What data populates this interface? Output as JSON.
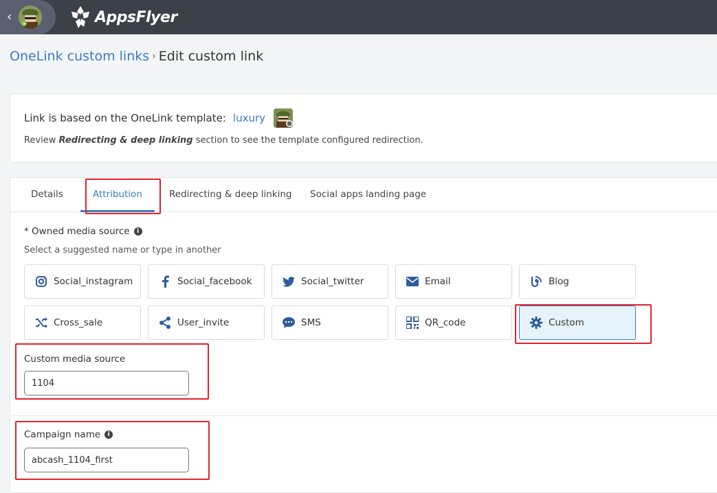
{
  "topbar": {
    "back_icon": "chevron-left-icon",
    "brand_name": "AppsFlyer"
  },
  "breadcrumb": {
    "parent": "OneLink custom links",
    "separator": "›",
    "current": "Edit custom link"
  },
  "template_info": {
    "prefix": "Link is based on the OneLink template:",
    "template_name": "luxury",
    "review_before": "Review ",
    "review_bold": "Redirecting & deep linking",
    "review_after": " section to see the template configured redirection."
  },
  "tabs": [
    {
      "label": "Details",
      "active": false
    },
    {
      "label": "Attribution",
      "active": true
    },
    {
      "label": "Redirecting & deep linking",
      "active": false
    },
    {
      "label": "Social apps landing page",
      "active": false
    }
  ],
  "owned_media": {
    "label": "* Owned media source",
    "hint": "Select a suggested name or type in another",
    "sources": [
      {
        "label": "Social_instagram",
        "icon": "instagram-icon",
        "selected": false
      },
      {
        "label": "Social_facebook",
        "icon": "facebook-icon",
        "selected": false
      },
      {
        "label": "Social_twitter",
        "icon": "twitter-icon",
        "selected": false
      },
      {
        "label": "Email",
        "icon": "envelope-icon",
        "selected": false
      },
      {
        "label": "Blog",
        "icon": "blog-icon",
        "selected": false
      },
      {
        "label": "Cross_sale",
        "icon": "shuffle-icon",
        "selected": false
      },
      {
        "label": "User_invite",
        "icon": "share-icon",
        "selected": false
      },
      {
        "label": "SMS",
        "icon": "chat-bubble-icon",
        "selected": false
      },
      {
        "label": "QR_code",
        "icon": "qr-code-icon",
        "selected": false
      },
      {
        "label": "Custom",
        "icon": "gear-icon",
        "selected": true
      }
    ]
  },
  "custom_media": {
    "label": "Custom media source",
    "value": "1104"
  },
  "campaign": {
    "label": "Campaign name",
    "value": "abcash_1104_first"
  },
  "colors": {
    "accent": "#3a7bc8",
    "highlight": "#e0232b",
    "topbar": "#3c4049"
  }
}
